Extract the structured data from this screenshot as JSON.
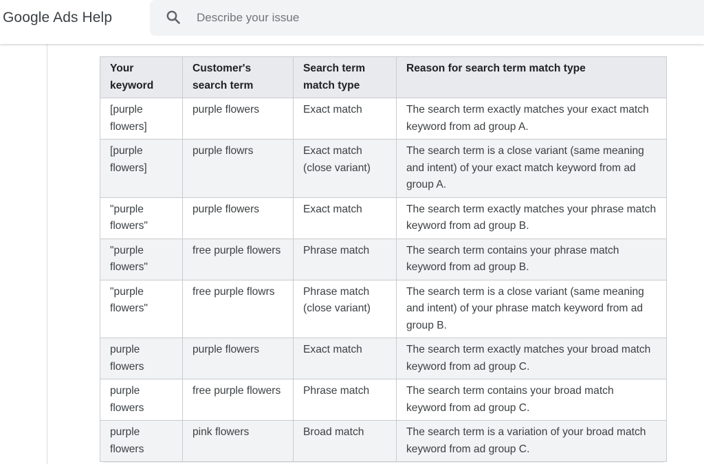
{
  "header": {
    "title": "Google Ads Help",
    "search_placeholder": "Describe your issue",
    "search_value": ""
  },
  "table": {
    "columns": [
      "Your keyword",
      "Customer's search term",
      "Search term match type",
      "Reason for search term match type"
    ],
    "rows": [
      [
        "[purple flowers]",
        "purple flowers",
        "Exact match",
        "The search term exactly matches your exact match keyword from ad group A."
      ],
      [
        "[purple flowers]",
        "purple flowrs",
        "Exact match (close variant)",
        "The search term is a close variant (same meaning and intent) of your exact match keyword from ad group A."
      ],
      [
        "\"purple flowers\"",
        "purple flowers",
        "Exact match",
        "The search term exactly matches your phrase match keyword from ad group B."
      ],
      [
        "\"purple flowers\"",
        "free purple flowers",
        "Phrase match",
        "The search term contains your phrase match keyword from ad group B."
      ],
      [
        "\"purple flowers\"",
        "free purple flowrs",
        "Phrase match (close variant)",
        "The search term is a close variant (same meaning and intent) of your phrase match keyword from ad group B."
      ],
      [
        "purple flowers",
        "purple flowers",
        "Exact match",
        "The search term exactly matches your broad match keyword from ad group C."
      ],
      [
        "purple flowers",
        "free purple flowers",
        "Phrase match",
        "The search term contains your broad match keyword from ad group C."
      ],
      [
        "purple flowers",
        "pink flowers",
        "Broad match",
        "The search term is a variation of your broad match keyword from ad group C."
      ]
    ]
  },
  "icons": {
    "search": "search-icon"
  },
  "colors": {
    "header_bg": "#e8eaed",
    "stripe_bg": "#f1f3f4",
    "border": "#c9cbcf",
    "search_bg": "#f1f3f4"
  }
}
